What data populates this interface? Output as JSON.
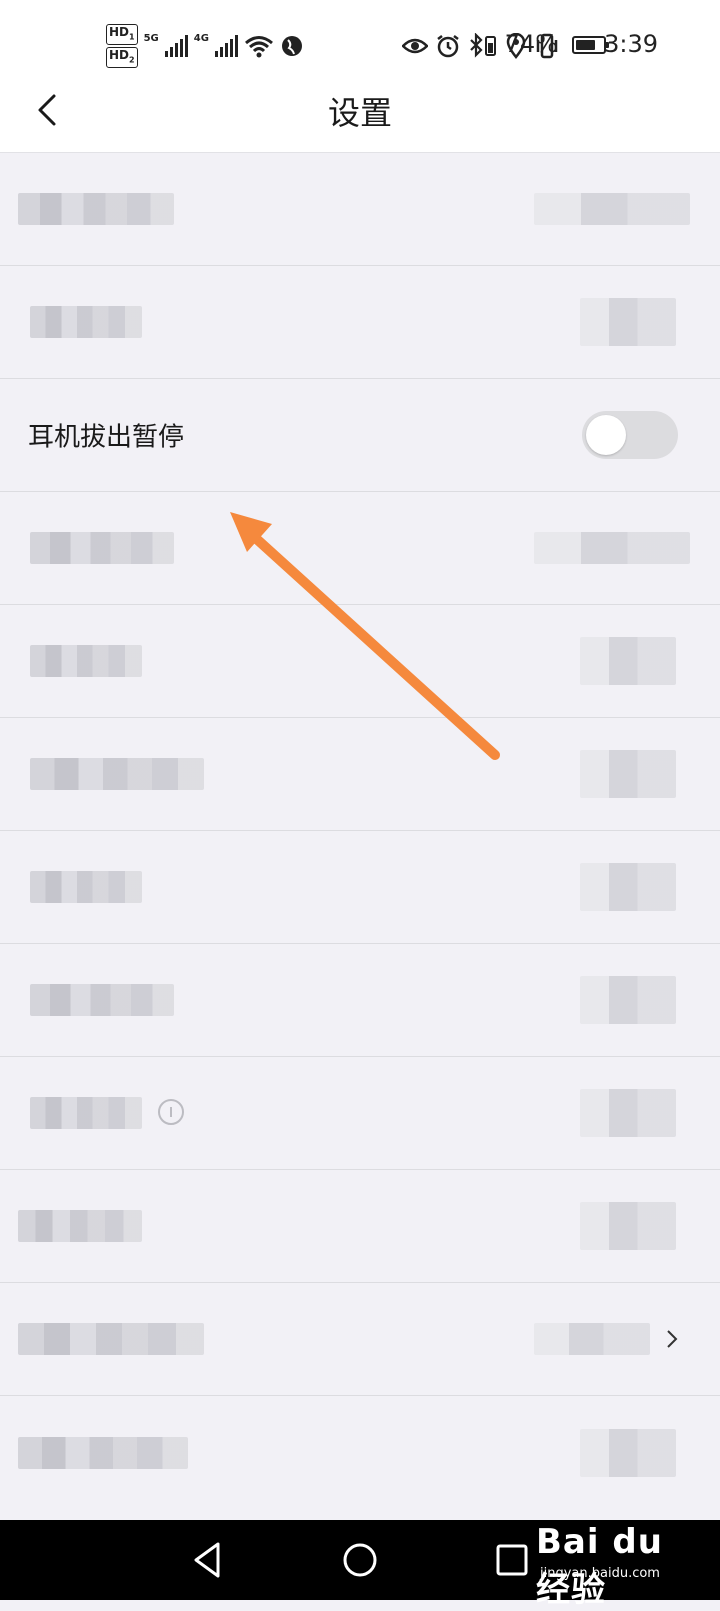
{
  "status_bar": {
    "hd1": "HD",
    "hd1_sub": "1",
    "hd2": "HD",
    "hd2_sub": "2",
    "net1": "5G",
    "net2": "4G",
    "battery_percent": "74%",
    "time": "3:39",
    "battery_level": 0.74
  },
  "header": {
    "title": "设置"
  },
  "settings": {
    "headphone_pause_label": "耳机拔出暂停",
    "headphone_pause_on": false
  },
  "watermark": {
    "brand": "Bai du 经验",
    "site": "jingyan.baidu.com"
  },
  "colors": {
    "accent_arrow": "#f5893d",
    "background": "#f2f1f6",
    "toggle_off": "#dcdcdf"
  }
}
